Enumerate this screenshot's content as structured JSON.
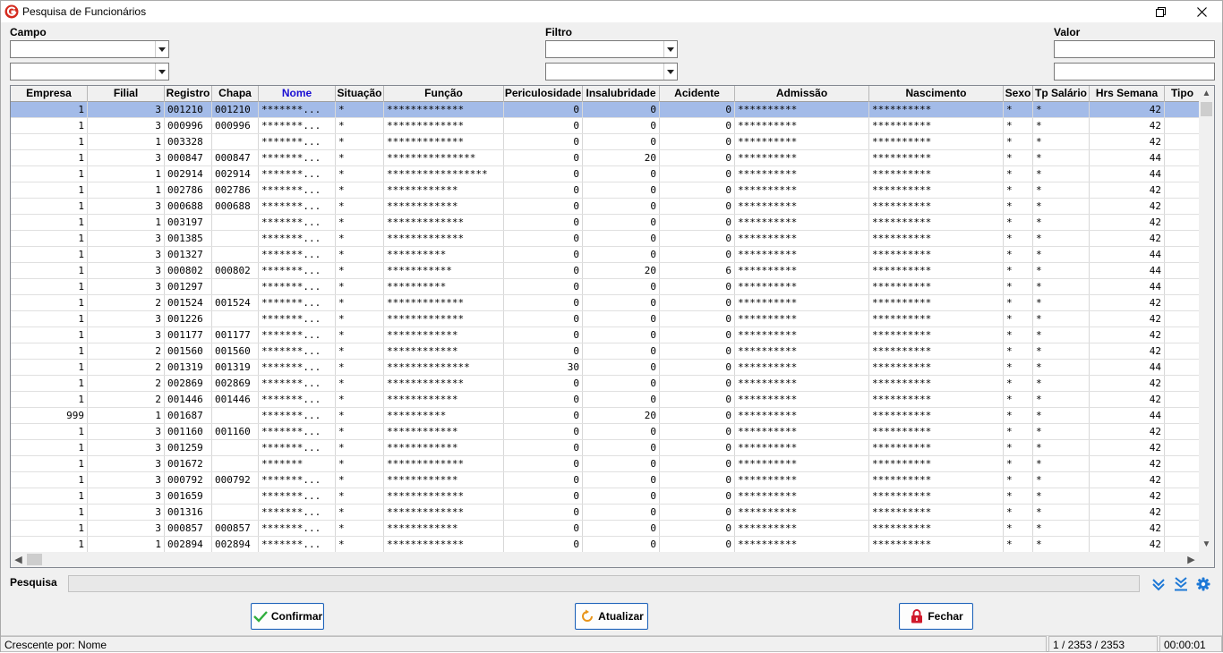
{
  "window": {
    "title": "Pesquisa de Funcionários"
  },
  "icons": {
    "app": "app-logo-icon",
    "restore": "restore-icon",
    "close": "close-icon"
  },
  "filters": {
    "campo_label": "Campo",
    "filtro_label": "Filtro",
    "valor_label": "Valor",
    "campo1": "",
    "campo2": "",
    "filtro1": "",
    "filtro2": "",
    "valor1": "",
    "valor2": ""
  },
  "grid": {
    "sorted_column": "Nome",
    "columns": [
      "Empresa",
      "Filial",
      "Registro",
      "Chapa",
      "Nome",
      "Situação",
      "Função",
      "Periculosidade",
      "Insalubridade",
      "Acidente",
      "Admissão",
      "Nascimento",
      "Sexo",
      "Tp Salário",
      "Hrs Semana",
      "Tipo"
    ],
    "rows": [
      [
        "1",
        "3",
        "001210",
        "001210",
        "*******...",
        "*",
        "*************",
        "0",
        "0",
        "0",
        "**********",
        "**********",
        "*",
        "*",
        "42",
        ""
      ],
      [
        "1",
        "3",
        "000996",
        "000996",
        "*******...",
        "*",
        "*************",
        "0",
        "0",
        "0",
        "**********",
        "**********",
        "*",
        "*",
        "42",
        ""
      ],
      [
        "1",
        "1",
        "003328",
        "",
        "*******...",
        "*",
        "*************",
        "0",
        "0",
        "0",
        "**********",
        "**********",
        "*",
        "*",
        "42",
        ""
      ],
      [
        "1",
        "3",
        "000847",
        "000847",
        "*******...",
        "*",
        "***************",
        "0",
        "20",
        "0",
        "**********",
        "**********",
        "*",
        "*",
        "44",
        ""
      ],
      [
        "1",
        "1",
        "002914",
        "002914",
        "*******...",
        "*",
        "*****************",
        "0",
        "0",
        "0",
        "**********",
        "**********",
        "*",
        "*",
        "44",
        ""
      ],
      [
        "1",
        "1",
        "002786",
        "002786",
        "*******...",
        "*",
        "************",
        "0",
        "0",
        "0",
        "**********",
        "**********",
        "*",
        "*",
        "42",
        ""
      ],
      [
        "1",
        "3",
        "000688",
        "000688",
        "*******...",
        "*",
        "************",
        "0",
        "0",
        "0",
        "**********",
        "**********",
        "*",
        "*",
        "42",
        ""
      ],
      [
        "1",
        "1",
        "003197",
        "",
        "*******...",
        "*",
        "*************",
        "0",
        "0",
        "0",
        "**********",
        "**********",
        "*",
        "*",
        "42",
        ""
      ],
      [
        "1",
        "3",
        "001385",
        "",
        "*******...",
        "*",
        "*************",
        "0",
        "0",
        "0",
        "**********",
        "**********",
        "*",
        "*",
        "42",
        ""
      ],
      [
        "1",
        "3",
        "001327",
        "",
        "*******...",
        "*",
        "**********",
        "0",
        "0",
        "0",
        "**********",
        "**********",
        "*",
        "*",
        "44",
        ""
      ],
      [
        "1",
        "3",
        "000802",
        "000802",
        "*******...",
        "*",
        "***********",
        "0",
        "20",
        "6",
        "**********",
        "**********",
        "*",
        "*",
        "44",
        ""
      ],
      [
        "1",
        "3",
        "001297",
        "",
        "*******...",
        "*",
        "**********",
        "0",
        "0",
        "0",
        "**********",
        "**********",
        "*",
        "*",
        "44",
        ""
      ],
      [
        "1",
        "2",
        "001524",
        "001524",
        "*******...",
        "*",
        "*************",
        "0",
        "0",
        "0",
        "**********",
        "**********",
        "*",
        "*",
        "42",
        ""
      ],
      [
        "1",
        "3",
        "001226",
        "",
        "*******...",
        "*",
        "*************",
        "0",
        "0",
        "0",
        "**********",
        "**********",
        "*",
        "*",
        "42",
        ""
      ],
      [
        "1",
        "3",
        "001177",
        "001177",
        "*******...",
        "*",
        "************",
        "0",
        "0",
        "0",
        "**********",
        "**********",
        "*",
        "*",
        "42",
        ""
      ],
      [
        "1",
        "2",
        "001560",
        "001560",
        "*******...",
        "*",
        "************",
        "0",
        "0",
        "0",
        "**********",
        "**********",
        "*",
        "*",
        "42",
        ""
      ],
      [
        "1",
        "2",
        "001319",
        "001319",
        "*******...",
        "*",
        "**************",
        "30",
        "0",
        "0",
        "**********",
        "**********",
        "*",
        "*",
        "44",
        ""
      ],
      [
        "1",
        "2",
        "002869",
        "002869",
        "*******...",
        "*",
        "*************",
        "0",
        "0",
        "0",
        "**********",
        "**********",
        "*",
        "*",
        "42",
        ""
      ],
      [
        "1",
        "2",
        "001446",
        "001446",
        "*******...",
        "*",
        "************",
        "0",
        "0",
        "0",
        "**********",
        "**********",
        "*",
        "*",
        "42",
        ""
      ],
      [
        "999",
        "1",
        "001687",
        "",
        "*******...",
        "*",
        "**********",
        "0",
        "20",
        "0",
        "**********",
        "**********",
        "*",
        "*",
        "44",
        ""
      ],
      [
        "1",
        "3",
        "001160",
        "001160",
        "*******...",
        "*",
        "************",
        "0",
        "0",
        "0",
        "**********",
        "**********",
        "*",
        "*",
        "42",
        ""
      ],
      [
        "1",
        "3",
        "001259",
        "",
        "*******...",
        "*",
        "************",
        "0",
        "0",
        "0",
        "**********",
        "**********",
        "*",
        "*",
        "42",
        ""
      ],
      [
        "1",
        "3",
        "001672",
        "",
        "*******",
        "*",
        "*************",
        "0",
        "0",
        "0",
        "**********",
        "**********",
        "*",
        "*",
        "42",
        ""
      ],
      [
        "1",
        "3",
        "000792",
        "000792",
        "*******...",
        "*",
        "************",
        "0",
        "0",
        "0",
        "**********",
        "**********",
        "*",
        "*",
        "42",
        ""
      ],
      [
        "1",
        "3",
        "001659",
        "",
        "*******...",
        "*",
        "*************",
        "0",
        "0",
        "0",
        "**********",
        "**********",
        "*",
        "*",
        "42",
        ""
      ],
      [
        "1",
        "3",
        "001316",
        "",
        "*******...",
        "*",
        "*************",
        "0",
        "0",
        "0",
        "**********",
        "**********",
        "*",
        "*",
        "42",
        ""
      ],
      [
        "1",
        "3",
        "000857",
        "000857",
        "*******...",
        "*",
        "************",
        "0",
        "0",
        "0",
        "**********",
        "**********",
        "*",
        "*",
        "42",
        ""
      ],
      [
        "1",
        "1",
        "002894",
        "002894",
        "*******...",
        "*",
        "*************",
        "0",
        "0",
        "0",
        "**********",
        "**********",
        "*",
        "*",
        "42",
        ""
      ]
    ]
  },
  "search": {
    "label": "Pesquisa",
    "value": "",
    "icons": [
      "chevron-double-down-icon",
      "chevron-double-down-underline-icon",
      "gear-icon"
    ]
  },
  "buttons": {
    "confirm": "Confirmar",
    "refresh": "Atualizar",
    "close": "Fechar"
  },
  "status": {
    "sort": "Crescente por: Nome",
    "count": "1 / 2353 / 2353",
    "time": "00:00:01"
  },
  "colors": {
    "selection": "#a3bbe8",
    "accent": "#1d62b8",
    "sorted_header": "#1a0fd3"
  }
}
